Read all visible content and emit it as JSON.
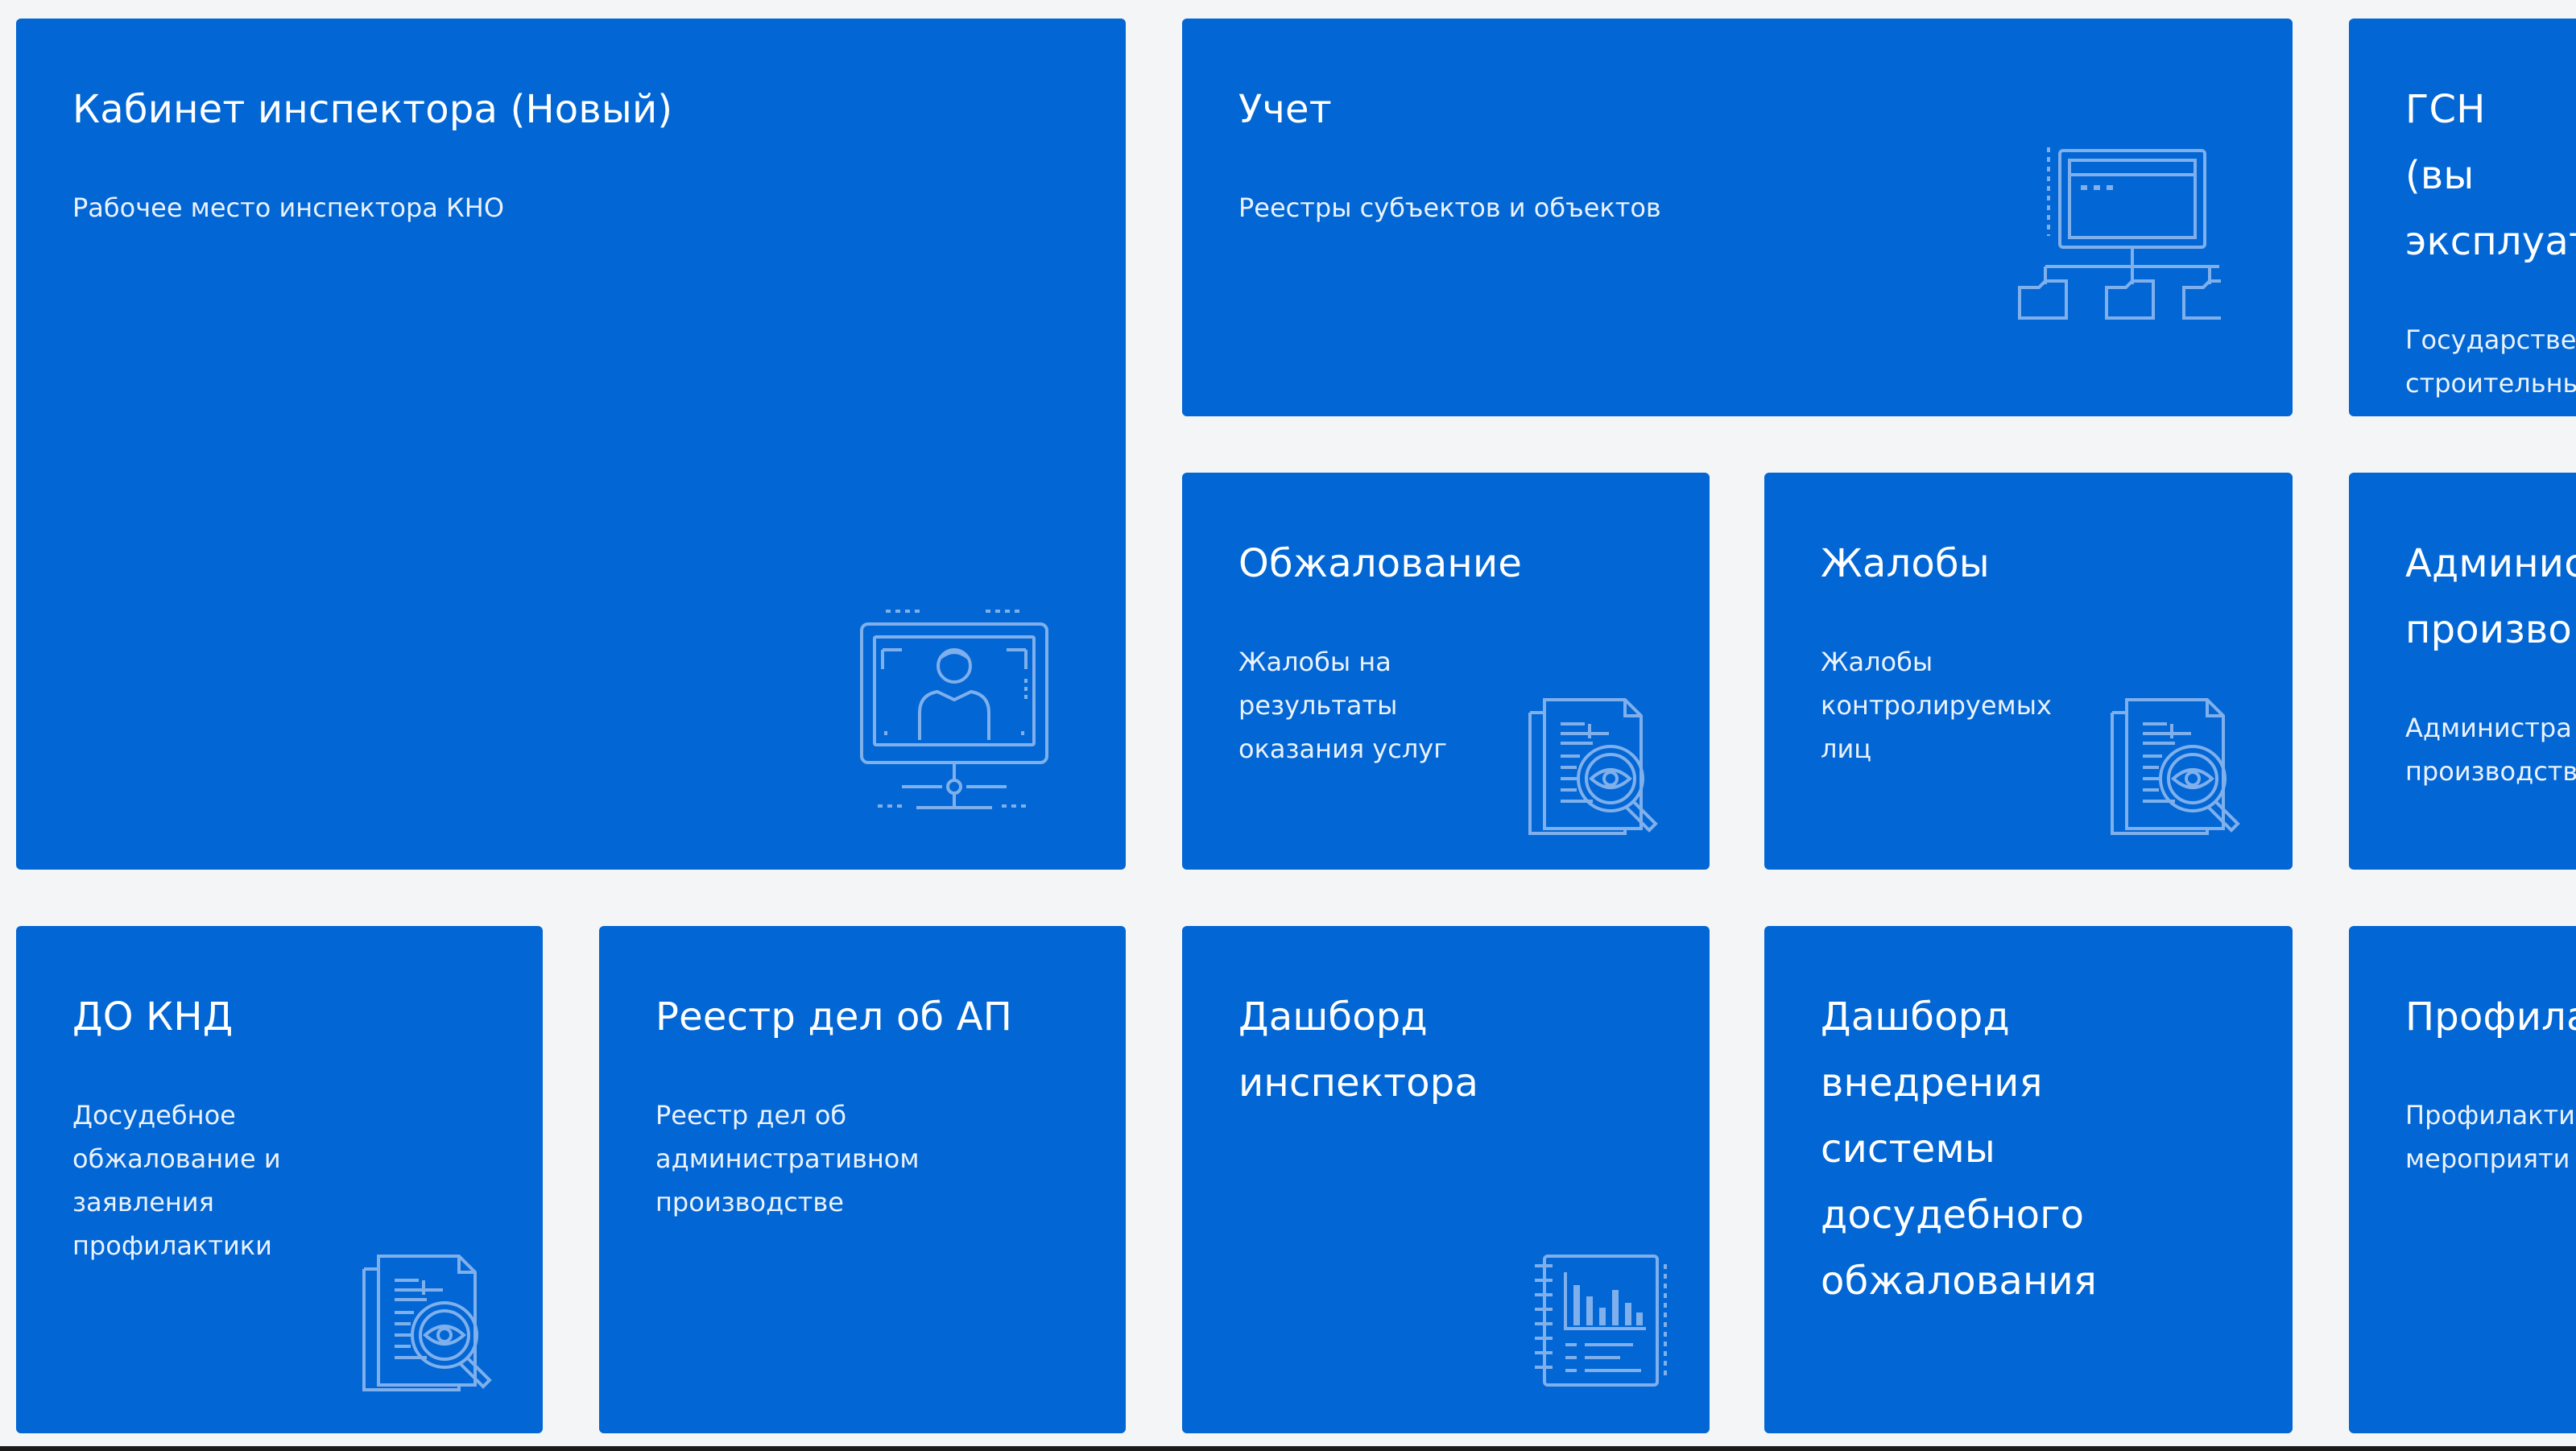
{
  "tiles": {
    "inspector": {
      "title": "Кабинет инспектора (Новый)",
      "desc": "Рабочее место инспектора КНО"
    },
    "uchet": {
      "title": "Учет",
      "desc": "Реестры субъектов и объектов"
    },
    "gsn": {
      "title": "ГСН (вы\nэксплуат",
      "desc": "Государстве\nстроительны\nнадзор"
    },
    "obzhalovanie": {
      "title": "Обжалование",
      "desc": "Жалобы на\nрезультаты\nоказания услуг"
    },
    "zhaloby": {
      "title": "Жалобы",
      "desc": "Жалобы\nконтролируемых\nлиц"
    },
    "admin": {
      "title": "Админис\nпроизво",
      "desc": "Администра\nпроизводств"
    },
    "do_knd": {
      "title": "ДО КНД",
      "desc": "Досудебное\nобжалование и\nзаявления\nпрофилактики"
    },
    "reestr_ap": {
      "title": "Реестр дел об АП",
      "desc": "Реестр дел об\nадминистративном\nпроизводстве"
    },
    "dashboard_inspector": {
      "title": "Дашборд\nинспектора",
      "desc": ""
    },
    "dashboard_do": {
      "title": "Дашборд\nвнедрения\nсистемы\nдосудебного\nобжалования",
      "desc": ""
    },
    "profilaktika": {
      "title": "Профила",
      "desc": "Профилакти\nмероприяти"
    }
  },
  "icons": {
    "inspector": "monitor-user-icon",
    "uchet": "registry-folders-icon",
    "obzhalovanie": "document-search-icon",
    "zhaloby": "document-search-icon",
    "do_knd": "document-search-icon",
    "dashboard_inspector": "chart-notebook-icon"
  },
  "colors": {
    "tile": "#0266d4",
    "background": "#f4f5f6",
    "icon_stroke": "#7fb0ec"
  }
}
